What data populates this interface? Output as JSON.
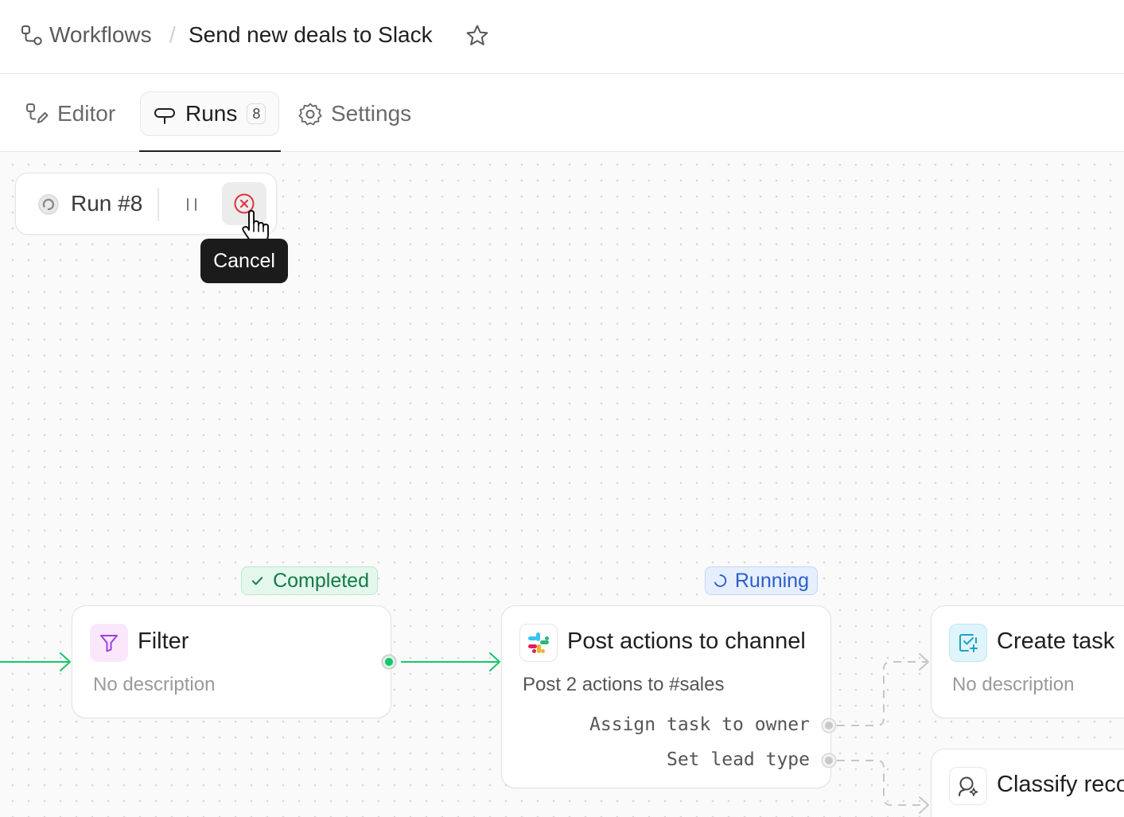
{
  "breadcrumb": {
    "section": "Workflows",
    "separator": "/",
    "title": "Send new deals to Slack"
  },
  "tabs": [
    {
      "label": "Editor",
      "icon": "editor-icon"
    },
    {
      "label": "Runs",
      "icon": "runs-icon",
      "count": "8",
      "active": true
    },
    {
      "label": "Settings",
      "icon": "gear-icon"
    }
  ],
  "run": {
    "label": "Run #8",
    "status_icon": "spinner-icon",
    "tooltip": "Cancel"
  },
  "nodes": {
    "filter": {
      "title": "Filter",
      "description": "No description",
      "status": "Completed",
      "icon": "filter-icon"
    },
    "post": {
      "title": "Post actions to channel",
      "description": "Post 2 actions to #sales",
      "status": "Running",
      "icon": "slack-icon",
      "branches": [
        "Assign task to owner",
        "Set lead type"
      ]
    },
    "create_task": {
      "title": "Create task",
      "description": "No description",
      "icon": "task-icon"
    },
    "classify": {
      "title": "Classify record",
      "icon": "classify-icon"
    }
  },
  "colors": {
    "completed": "#147a45",
    "running": "#2b5fc7",
    "edge_active": "#18c46b",
    "edge_pending": "#c6c6c6",
    "cancel": "#e0313f"
  }
}
